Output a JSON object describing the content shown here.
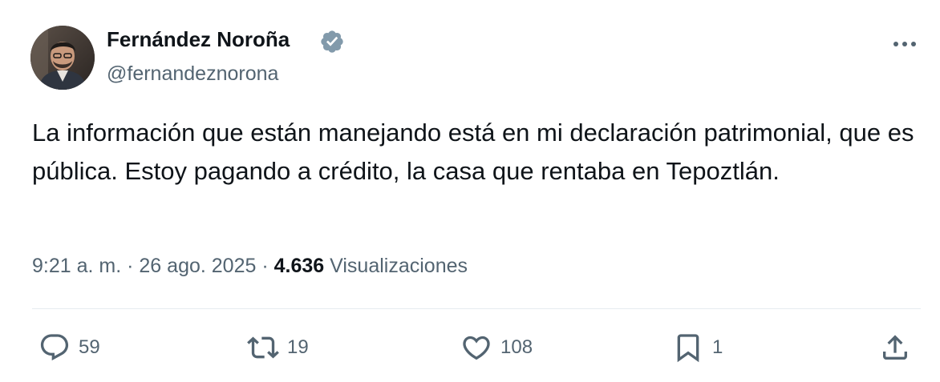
{
  "author": {
    "display_name": "Fernández Noroña",
    "handle": "@fernandeznorona",
    "verified": true
  },
  "tweet": {
    "text": "La información que están manejando está en mi declaración patrimonial, que es pública. Estoy pagando a crédito, la casa que rentaba en Tepoztlán.",
    "time": "9:21 a. m.",
    "separator": "·",
    "date": "26 ago. 2025",
    "views_count": "4.636",
    "views_label": "Visualizaciones"
  },
  "actions": {
    "replies": "59",
    "retweets": "19",
    "likes": "108",
    "bookmarks": "1"
  },
  "icons": {
    "verified": "verified-badge-icon",
    "more": "more-options-icon",
    "reply": "reply-icon",
    "retweet": "retweet-icon",
    "like": "heart-icon",
    "bookmark": "bookmark-icon",
    "share": "share-icon"
  },
  "colors": {
    "text": "#0f1419",
    "secondary": "#536471",
    "divider": "#e6ecf0",
    "badge": "#829aab"
  }
}
